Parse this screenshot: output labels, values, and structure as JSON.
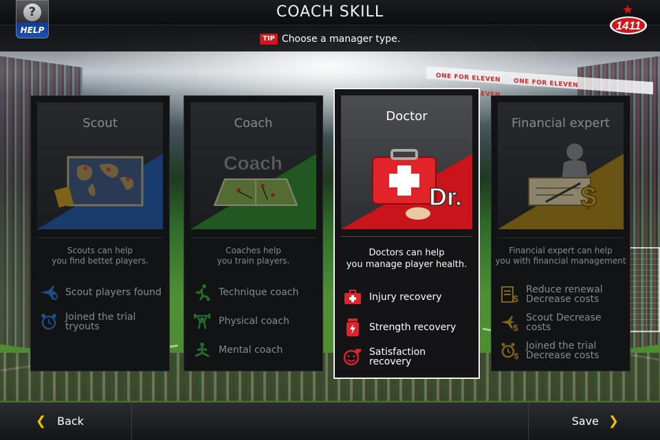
{
  "header": {
    "title": "COACH SKILL",
    "help_label": "HELP",
    "help_glyph": "?",
    "logo_text": "1411"
  },
  "tip": {
    "badge": "TIP",
    "text": "Choose a manager type."
  },
  "background": {
    "banner_text": "ONE FOR ELEVEN"
  },
  "cards": [
    {
      "name": "Scout",
      "desc_line1": "Scouts can help",
      "desc_line2": "you find bettet players.",
      "accent": "#1f5fb4",
      "state": "unselected",
      "features": [
        {
          "icon": "plane-search-icon",
          "line1": "Scout players found",
          "line2": ""
        },
        {
          "icon": "alarm-clock-icon",
          "line1": "Joined the trial",
          "line2": "tryouts"
        }
      ]
    },
    {
      "name": "Coach",
      "art_text": "Coach",
      "desc_line1": "Coaches help",
      "desc_line2": "you train players.",
      "accent": "#2e8f2a",
      "state": "unselected",
      "features": [
        {
          "icon": "kicking-player-icon",
          "line1": "Technique coach",
          "line2": ""
        },
        {
          "icon": "weightlifter-icon",
          "line1": "Physical coach",
          "line2": ""
        },
        {
          "icon": "meditation-icon",
          "line1": "Mental coach",
          "line2": ""
        }
      ]
    },
    {
      "name": "Doctor",
      "art_text": "Dr.",
      "desc_line1": "Doctors can help",
      "desc_line2": "you manage player health.",
      "accent": "#c8141a",
      "state": "selected",
      "features": [
        {
          "icon": "first-aid-kit-icon",
          "line1": "Injury recovery",
          "line2": ""
        },
        {
          "icon": "energy-drink-icon",
          "line1": "Strength recovery",
          "line2": ""
        },
        {
          "icon": "smiley-heart-icon",
          "line1": "Satisfaction",
          "line2": "recovery"
        }
      ]
    },
    {
      "name": "Financial expert",
      "desc_line1": "Financial expert can help",
      "desc_line2": "you with financial management",
      "accent": "#b08a12",
      "state": "unselected",
      "features": [
        {
          "icon": "contract-dollar-icon",
          "line1": "Reduce renewal",
          "line2": "Decrease costs"
        },
        {
          "icon": "plane-dollar-icon",
          "line1": "Scout Decrease",
          "line2": "costs"
        },
        {
          "icon": "alarm-dollar-icon",
          "line1": "Joined the trial",
          "line2": "Decrease costs"
        }
      ]
    }
  ],
  "footer": {
    "back_label": "Back",
    "save_label": "Save",
    "accent": "#f2c400"
  }
}
